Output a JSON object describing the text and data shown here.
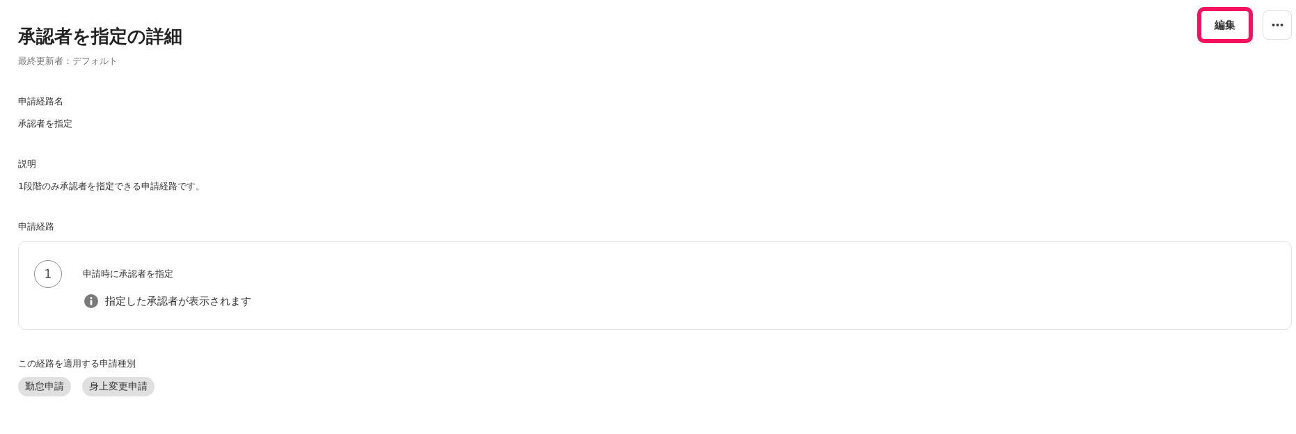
{
  "header": {
    "title": "承認者を指定の詳細",
    "updated_by": "最終更新者：デフォルト",
    "actions": [
      {
        "kind": "text",
        "label": "編集",
        "highlighted": true
      },
      {
        "kind": "more",
        "label": "•••",
        "highlighted": false
      }
    ]
  },
  "fields": [
    {
      "label": "申請経路名",
      "value": "承認者を指定"
    },
    {
      "label": "説明",
      "value": "1段階のみ承認者を指定できる申請経路です。"
    }
  ],
  "route": {
    "label": "申請経路",
    "steps": [
      {
        "number": "1",
        "title": "申請時に承認者を指定",
        "note": "指定した承認者が表示されます"
      }
    ]
  },
  "types": {
    "label": "この経路を適用する申請種別",
    "tags": [
      "勤怠申請",
      "身上変更申請"
    ]
  }
}
